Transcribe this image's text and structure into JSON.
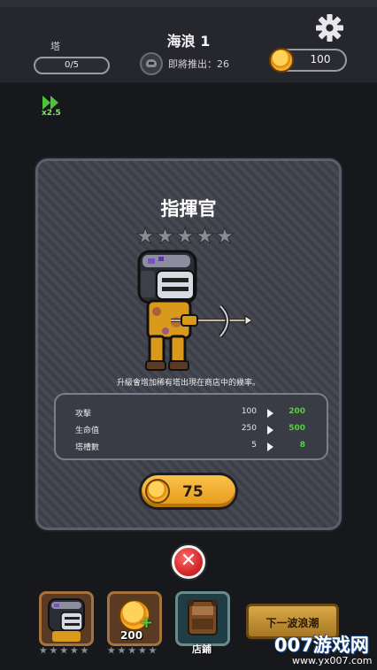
{
  "hud": {
    "tower_label": "塔",
    "tower_count": "0/5",
    "wave_title": "海浪 1",
    "coming_text": "即將推出：26",
    "coins": "100",
    "speed_label": "x2.5"
  },
  "hero": {
    "name": "指揮官",
    "stars_filled": 0,
    "stars_total": 5,
    "description": "升級會增加稀有塔出現在商店中的幾率。",
    "stats": [
      {
        "name": "攻擊",
        "current": "100",
        "next": "200"
      },
      {
        "name": "生命值",
        "current": "250",
        "next": "500"
      },
      {
        "name": "塔槽數",
        "current": "5",
        "next": "8"
      }
    ],
    "upgrade_price": "75"
  },
  "bottom": {
    "card_coin_value": "200",
    "shop_label": "店鋪",
    "next_wave_label": "下一波浪潮"
  },
  "watermark": {
    "brand": "007游戏网",
    "url": "www.yx007.com"
  },
  "colors": {
    "accent_gold": "#f5b02b",
    "upgrade_green": "#51d33b",
    "close_red": "#d32a2a"
  }
}
